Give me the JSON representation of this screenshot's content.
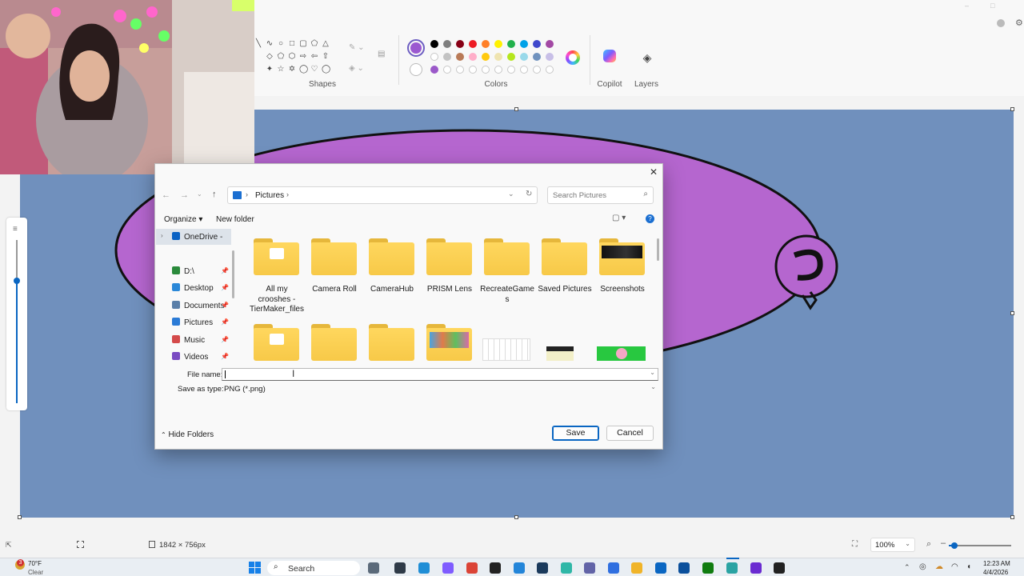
{
  "ribbon": {
    "groups": {
      "shapes": "Shapes",
      "colors": "Colors",
      "copilot": "Copilot",
      "layers": "Layers"
    },
    "colors_row1": [
      "#000000",
      "#7f7f7f",
      "#880015",
      "#ed1c24",
      "#ff7f27",
      "#fff200",
      "#22b14c",
      "#00a2e8",
      "#3f48cc",
      "#a349a4"
    ],
    "colors_row2": [
      "#ffffff",
      "#c3c3c3",
      "#b97a57",
      "#ffaec9",
      "#ffc90e",
      "#efe4b0",
      "#b5e61d",
      "#99d9ea",
      "#7092be",
      "#c8bfe7"
    ],
    "colors_row3": [
      "#9b59c9",
      "",
      "",
      "",
      "",
      "",
      "",
      "",
      "",
      ""
    ],
    "primary_color": "#9b59d0"
  },
  "canvas": {
    "background": "#7090bd",
    "shape_fill": "#b566cf"
  },
  "dialog": {
    "breadcrumb": "Pictures",
    "search_placeholder": "Search Pictures",
    "organize_label": "Organize",
    "new_folder_label": "New folder",
    "sidebar": [
      {
        "label": "OneDrive - Pe",
        "icon": "onedrive-icon",
        "color": "#0a62c4"
      },
      {
        "label": "D:\\",
        "icon": "download-icon",
        "color": "#2a8a3b"
      },
      {
        "label": "Desktop",
        "icon": "desktop-icon",
        "color": "#2b88d8"
      },
      {
        "label": "Documents",
        "icon": "documents-icon",
        "color": "#5a7fa8"
      },
      {
        "label": "Pictures",
        "icon": "pictures-icon",
        "color": "#2b7bd6"
      },
      {
        "label": "Music",
        "icon": "music-icon",
        "color": "#d44a4a"
      },
      {
        "label": "Videos",
        "icon": "videos-icon",
        "color": "#7a4bc2"
      }
    ],
    "folders": [
      {
        "label_lines": [
          "All my",
          "crooshes -",
          "TierMaker_files"
        ]
      },
      {
        "label_lines": [
          "Camera Roll"
        ]
      },
      {
        "label_lines": [
          "CameraHub"
        ]
      },
      {
        "label_lines": [
          "PRISM Lens"
        ]
      },
      {
        "label_lines": [
          "RecreateGame",
          "s"
        ]
      },
      {
        "label_lines": [
          "Saved Pictures"
        ]
      },
      {
        "label_lines": [
          "Screenshots"
        ]
      }
    ],
    "file_name_label": "File name:",
    "file_name_value": "",
    "save_type_label": "Save as type:",
    "save_type_value": "PNG (*.png)",
    "hide_folders_label": "Hide Folders",
    "save_label": "Save",
    "cancel_label": "Cancel"
  },
  "statusbar": {
    "dimensions": "1842 × 756px",
    "zoom": "100%"
  },
  "taskbar": {
    "weather_temp": "70°F",
    "weather_desc": "Clear",
    "search_label": "Search",
    "time": "12:23 AM",
    "date": "4/4/2026"
  }
}
